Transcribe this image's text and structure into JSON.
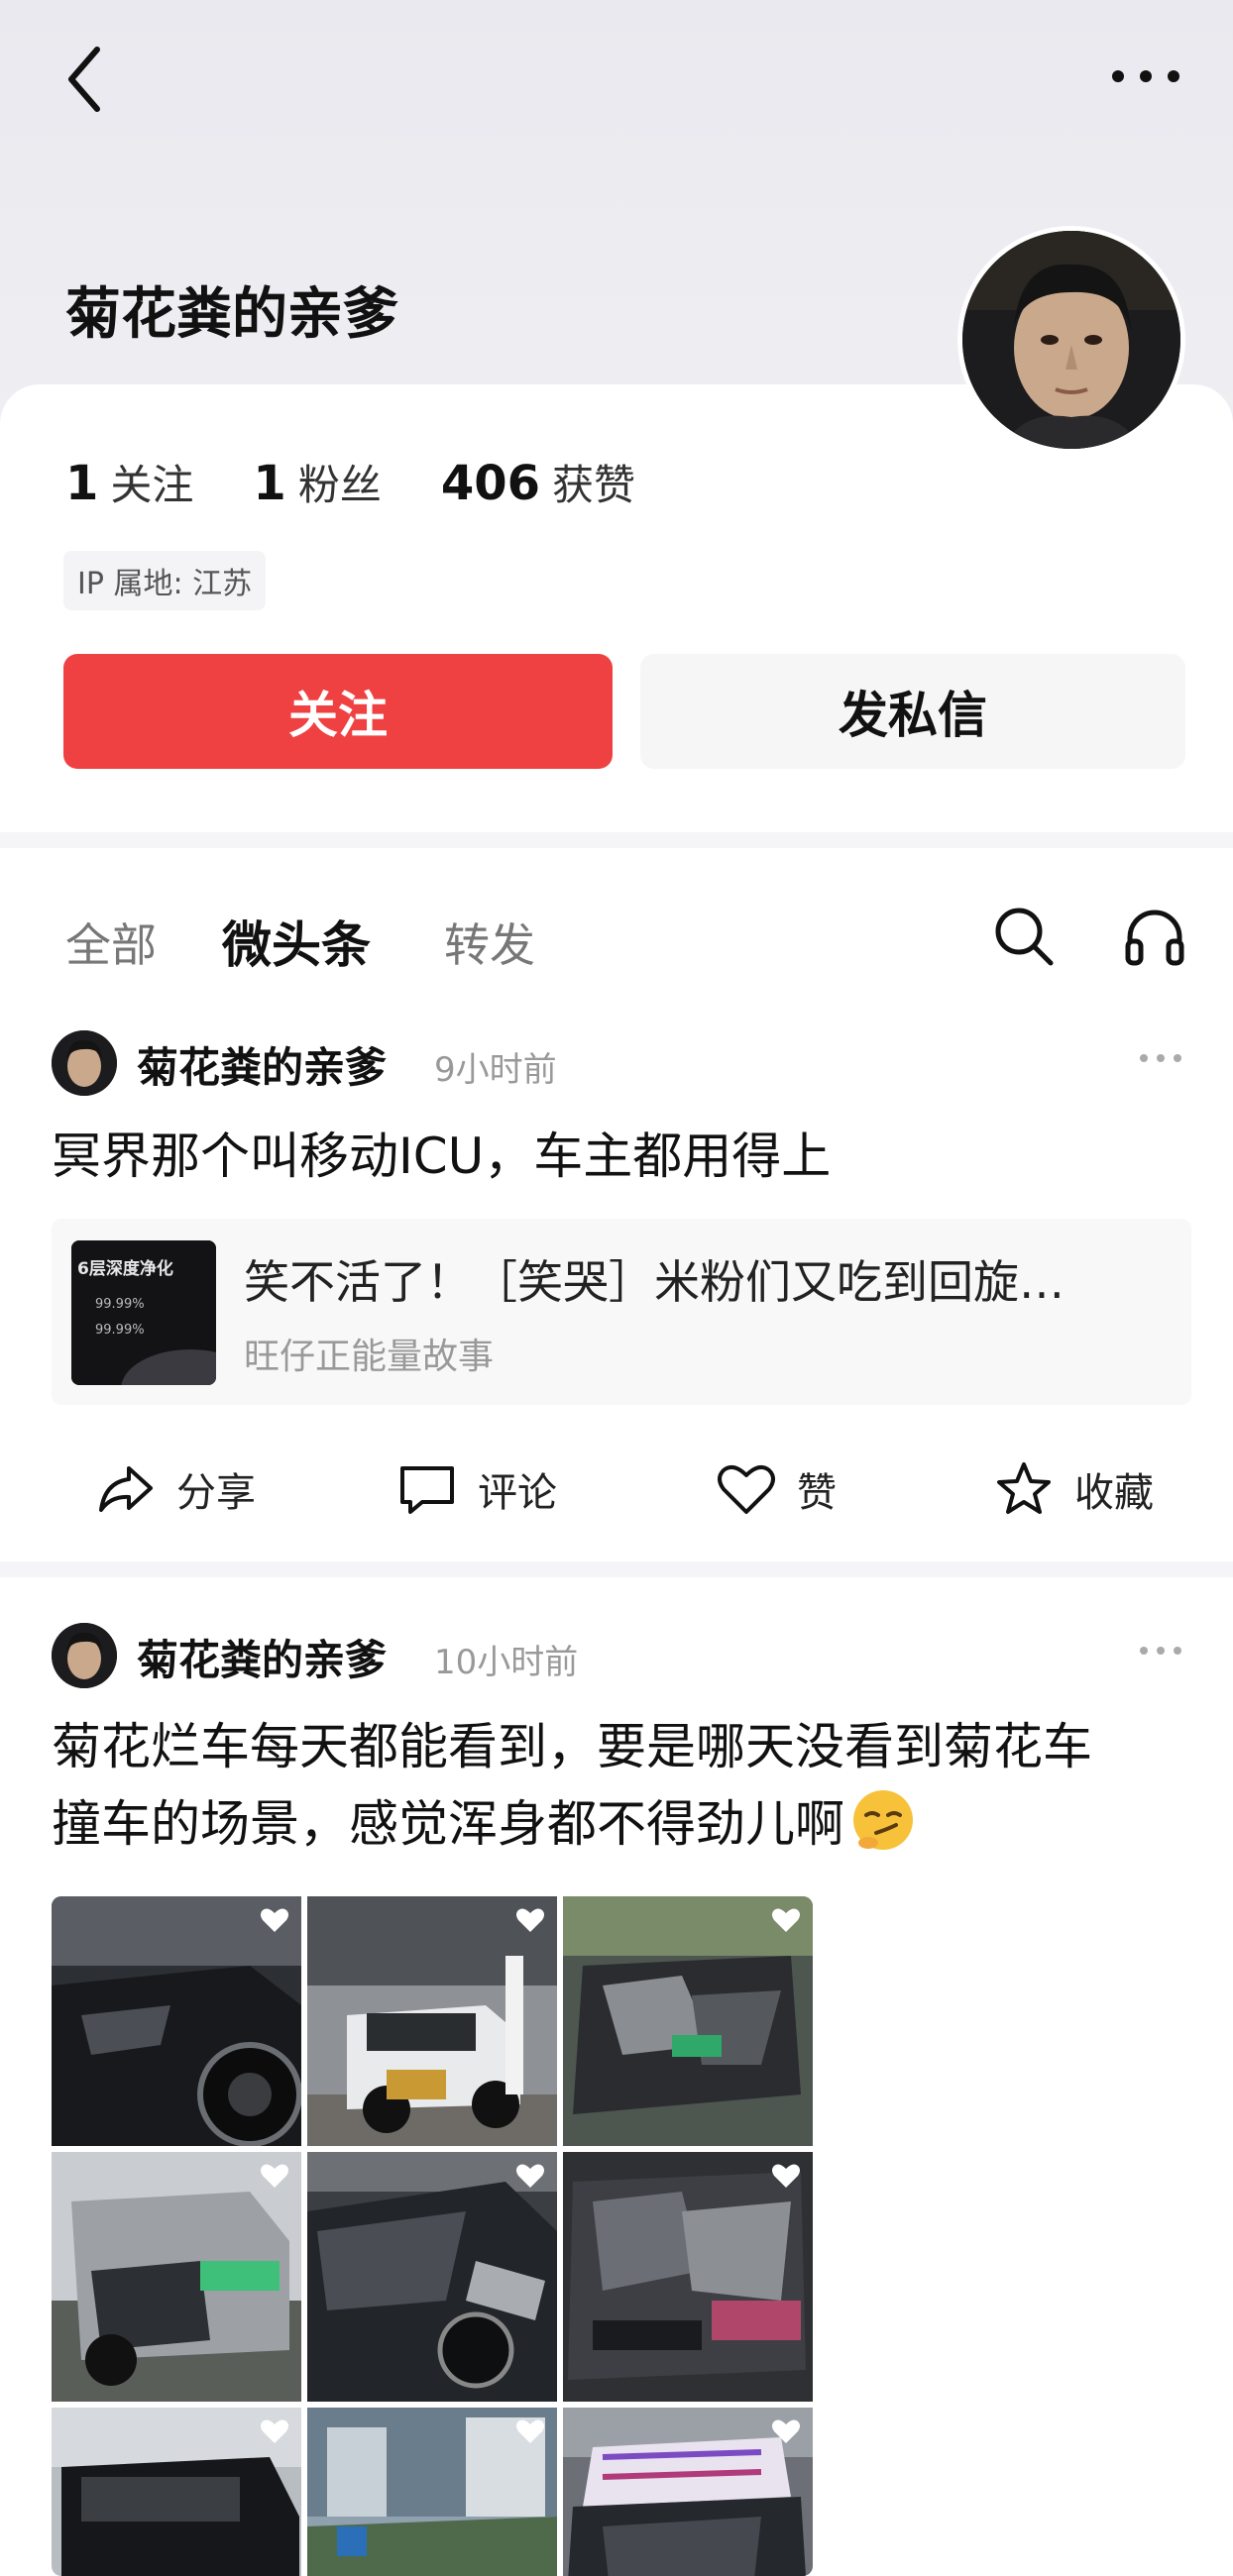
{
  "profile": {
    "name": "菊花粪的亲爹",
    "following_count": "1",
    "following_label": "关注",
    "followers_count": "1",
    "followers_label": "粉丝",
    "likes_count": "406",
    "likes_label": "获赞",
    "ip_location": "IP 属地: 江苏",
    "follow_button": "关注",
    "message_button": "发私信"
  },
  "tabs": [
    {
      "label": "全部",
      "active": false
    },
    {
      "label": "微头条",
      "active": true
    },
    {
      "label": "转发",
      "active": false
    }
  ],
  "icons": {
    "back": "back-arrow-icon",
    "more": "more-dots-icon",
    "search": "search-icon",
    "listen": "headphones-icon",
    "share": "share-icon",
    "comment": "comment-icon",
    "like": "heart-icon",
    "favorite": "star-icon"
  },
  "colors": {
    "accent": "#f04142",
    "text_primary": "#111111",
    "text_secondary": "#999999"
  },
  "posts": [
    {
      "author": "菊花粪的亲爹",
      "time": "9小时前",
      "text": "冥界那个叫移动ICU，车主都用得上",
      "link_card": {
        "thumb_text": "6层深度净化",
        "thumb_values": [
          "99.99%",
          "99.99%"
        ],
        "title": "笑不活了！［笑哭］米粉们又吃到回旋…",
        "source": "旺仔正能量故事"
      },
      "actions": {
        "share": "分享",
        "comment": "评论",
        "like": "赞",
        "favorite": "收藏"
      }
    },
    {
      "author": "菊花粪的亲爹",
      "time": "10小时前",
      "text_line1": "菊花烂车每天都能看到，要是哪天没看到菊花车",
      "text_line2": "撞车的场景，感觉浑身都不得劲儿啊",
      "emoji": "smirk-emoji",
      "image_count": 9
    }
  ]
}
